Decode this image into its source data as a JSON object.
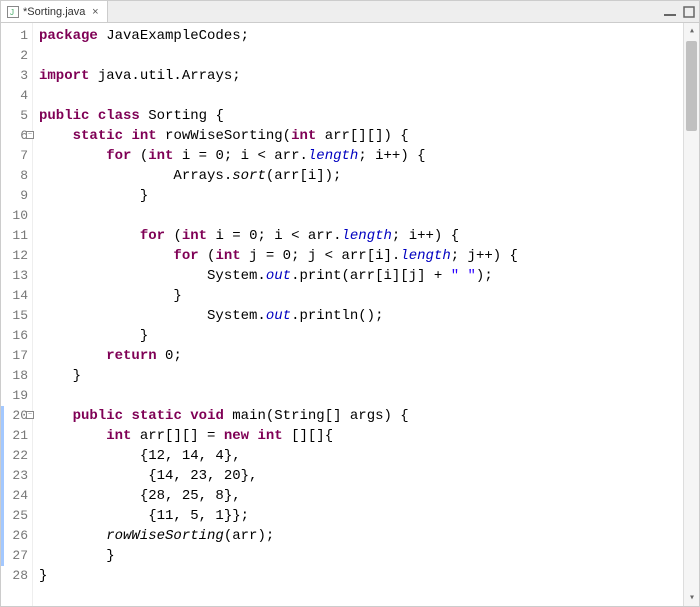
{
  "tab": {
    "title": "*Sorting.java",
    "close_glyph": "×"
  },
  "toolbar": {
    "minimize_icon": "minimize",
    "maximize_icon": "maximize"
  },
  "gutter": {
    "lines": [
      {
        "n": "1"
      },
      {
        "n": "2"
      },
      {
        "n": "3"
      },
      {
        "n": "4"
      },
      {
        "n": "5"
      },
      {
        "n": "6",
        "fold": true
      },
      {
        "n": "7"
      },
      {
        "n": "8"
      },
      {
        "n": "9"
      },
      {
        "n": "10"
      },
      {
        "n": "11"
      },
      {
        "n": "12"
      },
      {
        "n": "13"
      },
      {
        "n": "14"
      },
      {
        "n": "15"
      },
      {
        "n": "16"
      },
      {
        "n": "17"
      },
      {
        "n": "18"
      },
      {
        "n": "19"
      },
      {
        "n": "20",
        "fold": true,
        "highlight": true
      },
      {
        "n": "21",
        "highlight": true
      },
      {
        "n": "22",
        "highlight": true
      },
      {
        "n": "23",
        "highlight": true
      },
      {
        "n": "24",
        "highlight": true
      },
      {
        "n": "25",
        "highlight": true
      },
      {
        "n": "26",
        "highlight": true
      },
      {
        "n": "27",
        "highlight": true
      },
      {
        "n": "28"
      }
    ],
    "fold_glyph": "−"
  },
  "code": {
    "l1": {
      "kw_package": "package",
      "pkg": " JavaExampleCodes;"
    },
    "l3": {
      "kw_import": "import",
      "imp": " java.util.Arrays;"
    },
    "l5": {
      "kw_public": "public",
      "kw_class": "class",
      "name": " Sorting {"
    },
    "l6": {
      "indent": "    ",
      "kw_static": "static",
      "kw_int": "int",
      "method": " rowWiseSorting(",
      "kw_int2": "int",
      "rest": " arr[][]) {"
    },
    "l7": {
      "indent": "        ",
      "kw_for": "for",
      "open": " (",
      "kw_int": "int",
      "init": " i = 0; i < arr.",
      "fld_len": "length",
      "rest": "; i++) {"
    },
    "l8": {
      "indent": "                Arrays.",
      "m_sort": "sort",
      "rest": "(arr[i]);"
    },
    "l9": {
      "indent": "            }"
    },
    "l11": {
      "indent": "            ",
      "kw_for": "for",
      "open": " (",
      "kw_int": "int",
      "init": " i = 0; i < arr.",
      "fld_len": "length",
      "rest": "; i++) {"
    },
    "l12": {
      "indent": "                ",
      "kw_for": "for",
      "open": " (",
      "kw_int": "int",
      "init": " j = 0; j < arr[i].",
      "fld_len": "length",
      "rest": "; j++) {"
    },
    "l13": {
      "indent": "                    System.",
      "fld_out": "out",
      "dot": ".print(arr[i][j] + ",
      "str": "\" \"",
      "end": ");"
    },
    "l14": {
      "indent": "                }"
    },
    "l15": {
      "indent": "                    System.",
      "fld_out": "out",
      "rest": ".println();"
    },
    "l16": {
      "indent": "            }"
    },
    "l17": {
      "indent": "        ",
      "kw_return": "return",
      "rest": " 0;"
    },
    "l18": {
      "indent": "    }"
    },
    "l20": {
      "indent": "    ",
      "kw_public": "public",
      "kw_static": "static",
      "kw_void": "void",
      "main": " main(String[] args) {"
    },
    "l21": {
      "indent": "        ",
      "kw_int": "int",
      "mid": " arr[][] = ",
      "kw_new": "new",
      "kw_int2": "int",
      "rest": " [][]{"
    },
    "l22": {
      "indent": "            {12, 14, 4},"
    },
    "l23": {
      "indent": "             {14, 23, 20},"
    },
    "l24": {
      "indent": "            {28, 25, 8},"
    },
    "l25": {
      "indent": "             {11, 5, 1}};"
    },
    "l26": {
      "indent": "        ",
      "call": "rowWiseSorting",
      "rest": "(arr);"
    },
    "l27": {
      "indent": "        }"
    },
    "l28": {
      "text": "}"
    }
  }
}
